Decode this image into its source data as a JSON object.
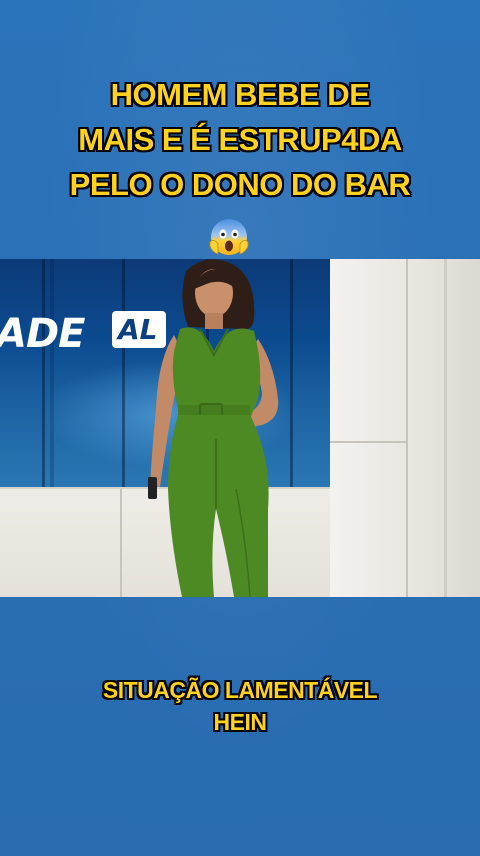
{
  "headline": {
    "lines": [
      "HOMEM BEBE DE",
      "MAIS E É ESTRUP4DA",
      "PELO O DONO DO BAR"
    ],
    "emoji": "face-screaming-in-fear"
  },
  "video": {
    "studio_logo_text": "ADE",
    "studio_logo_badge": "AL"
  },
  "caption": {
    "lines": [
      "SITUAÇÃO LAMENTÁVEL",
      "HEIN"
    ]
  },
  "colors": {
    "background": "#2a71b8",
    "text_fill": "#ffd21f",
    "text_outline": "#000000",
    "outfit_green": "#4e8a24"
  }
}
